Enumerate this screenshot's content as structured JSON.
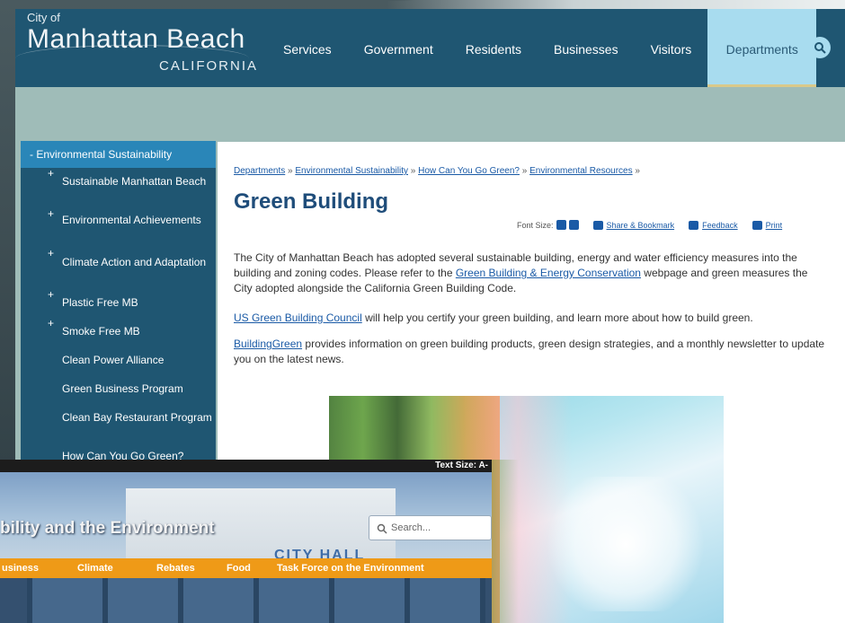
{
  "logo": {
    "small": "City of",
    "main": "Manhattan Beach",
    "sub": "CALIFORNIA"
  },
  "nav": [
    "Services",
    "Government",
    "Residents",
    "Businesses",
    "Visitors",
    "Departments"
  ],
  "sidebar": {
    "header": "- Environmental Sustainability",
    "items": [
      {
        "plus": "+",
        "label": "Sustainable Manhattan Beach"
      },
      {
        "plus": "+",
        "label": "Environmental Achievements"
      },
      {
        "plus": "+",
        "label": "Climate Action and Adaptation"
      },
      {
        "plus": "+",
        "label": "Plastic Free MB"
      },
      {
        "plus": "+",
        "label": "Smoke Free MB"
      },
      {
        "plus": "",
        "label": "Clean Power Alliance"
      },
      {
        "plus": "",
        "label": "Green Business Program"
      },
      {
        "plus": "",
        "label": "Clean Bay Restaurant Program"
      },
      {
        "plus": "",
        "label": "How Can You Go Green?"
      }
    ]
  },
  "breadcrumb": [
    "Departments",
    "Environmental Sustainability",
    "How Can You Go Green?",
    "Environmental Resources"
  ],
  "page_title": "Green Building",
  "tools": {
    "font_size": "Font Size:",
    "share": "Share & Bookmark",
    "feedback": "Feedback",
    "print": "Print"
  },
  "paragraphs": {
    "p1_before": "The City of Manhattan Beach has adopted several sustainable building, energy and water efficiency measures into the building and zoning codes. Please refer to the ",
    "p1_link": "Green Building & Energy Conservation",
    "p1_after": " webpage and green measures the City adopted alongside the California Green Building Code.",
    "p2_link": "US Green Building Council",
    "p2_after": " will help you certify your green building, and learn more about how to build green.",
    "p3_link": "BuildingGreen",
    "p3_after": " provides information on green building products, green design strategies, and a monthly newsletter to update you on the latest news."
  },
  "site2": {
    "text_size": "Text Size: A-",
    "title": "bility and the Environment",
    "city_hall": "CITY HALL",
    "search_placeholder": "Search...",
    "nav": [
      "usiness",
      "Climate",
      "Rebates",
      "Food",
      "Task Force on the Environment"
    ]
  },
  "colors": {
    "header": "#1f5672",
    "active_nav": "#a8dcef",
    "sidebar_head": "#2a86b8",
    "link": "#1a5aa6",
    "title": "#1f4d7a",
    "orange_nav": "#ef9a17"
  }
}
